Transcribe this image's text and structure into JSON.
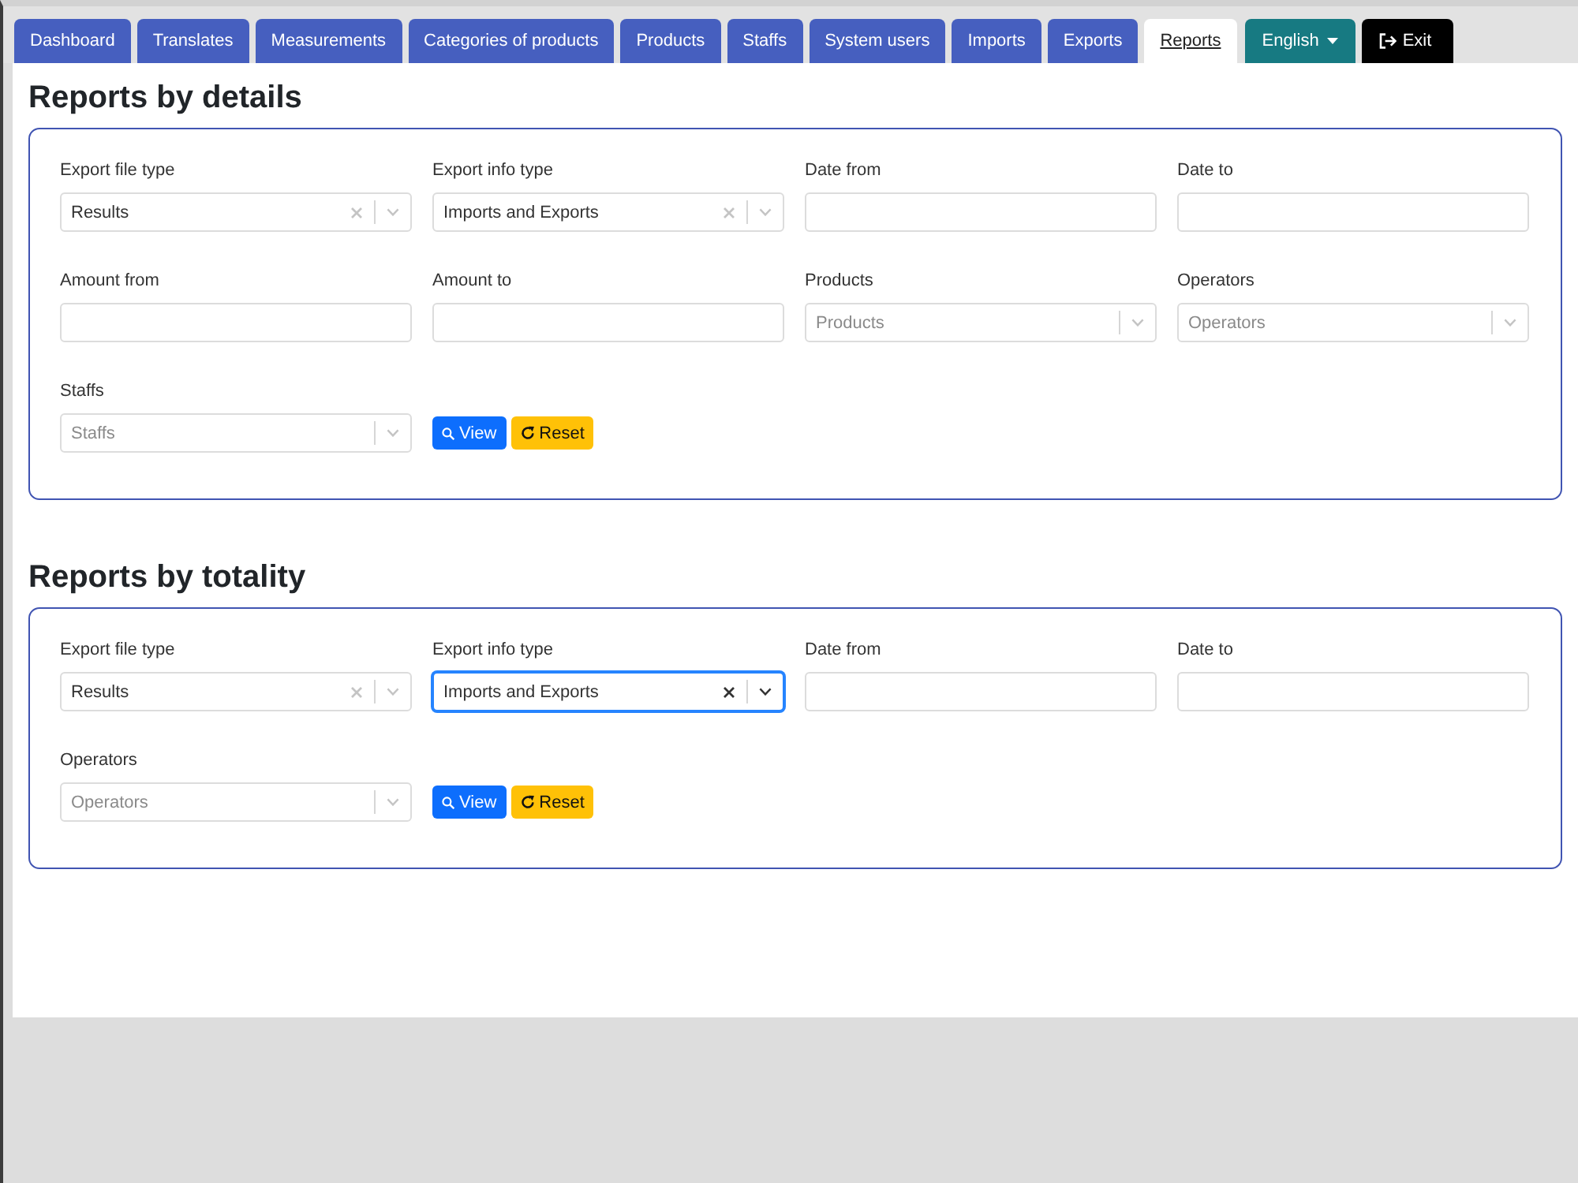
{
  "tabs": [
    {
      "label": "Dashboard",
      "selected": false
    },
    {
      "label": "Translates",
      "selected": false
    },
    {
      "label": "Measurements",
      "selected": false
    },
    {
      "label": "Categories of products",
      "selected": false
    },
    {
      "label": "Products",
      "selected": false
    },
    {
      "label": "Staffs",
      "selected": false
    },
    {
      "label": "System users",
      "selected": false
    },
    {
      "label": "Imports",
      "selected": false
    },
    {
      "label": "Exports",
      "selected": false
    },
    {
      "label": "Reports",
      "selected": true
    }
  ],
  "language_menu": {
    "label": "English"
  },
  "exit_button": {
    "label": "Exit"
  },
  "sections": [
    {
      "title": "Reports by details",
      "fields": [
        {
          "kind": "select",
          "label": "Export file type",
          "value": "Results",
          "focused": false
        },
        {
          "kind": "select",
          "label": "Export info type",
          "value": "Imports and Exports",
          "focused": false
        },
        {
          "kind": "text",
          "label": "Date from",
          "focused": false
        },
        {
          "kind": "text",
          "label": "Date to",
          "focused": false
        },
        {
          "kind": "text",
          "label": "Amount from",
          "focused": false
        },
        {
          "kind": "text",
          "label": "Amount to",
          "focused": false
        },
        {
          "kind": "select",
          "label": "Products",
          "placeholder": "Products",
          "focused": false
        },
        {
          "kind": "select",
          "label": "Operators",
          "placeholder": "Operators",
          "focused": false
        },
        {
          "kind": "select",
          "label": "Staffs",
          "placeholder": "Staffs",
          "focused": false
        }
      ],
      "buttons": [
        {
          "kind": "view",
          "label": "View"
        },
        {
          "kind": "reset",
          "label": "Reset"
        }
      ]
    },
    {
      "title": "Reports by totality",
      "fields": [
        {
          "kind": "select",
          "label": "Export file type",
          "value": "Results",
          "focused": false
        },
        {
          "kind": "select",
          "label": "Export info type",
          "value": "Imports and Exports",
          "focused": true
        },
        {
          "kind": "text",
          "label": "Date from",
          "focused": false
        },
        {
          "kind": "text",
          "label": "Date to",
          "focused": false
        },
        {
          "kind": "select",
          "label": "Operators",
          "placeholder": "Operators",
          "focused": false
        }
      ],
      "buttons": [
        {
          "kind": "view",
          "label": "View"
        },
        {
          "kind": "reset",
          "label": "Reset"
        }
      ]
    }
  ]
}
